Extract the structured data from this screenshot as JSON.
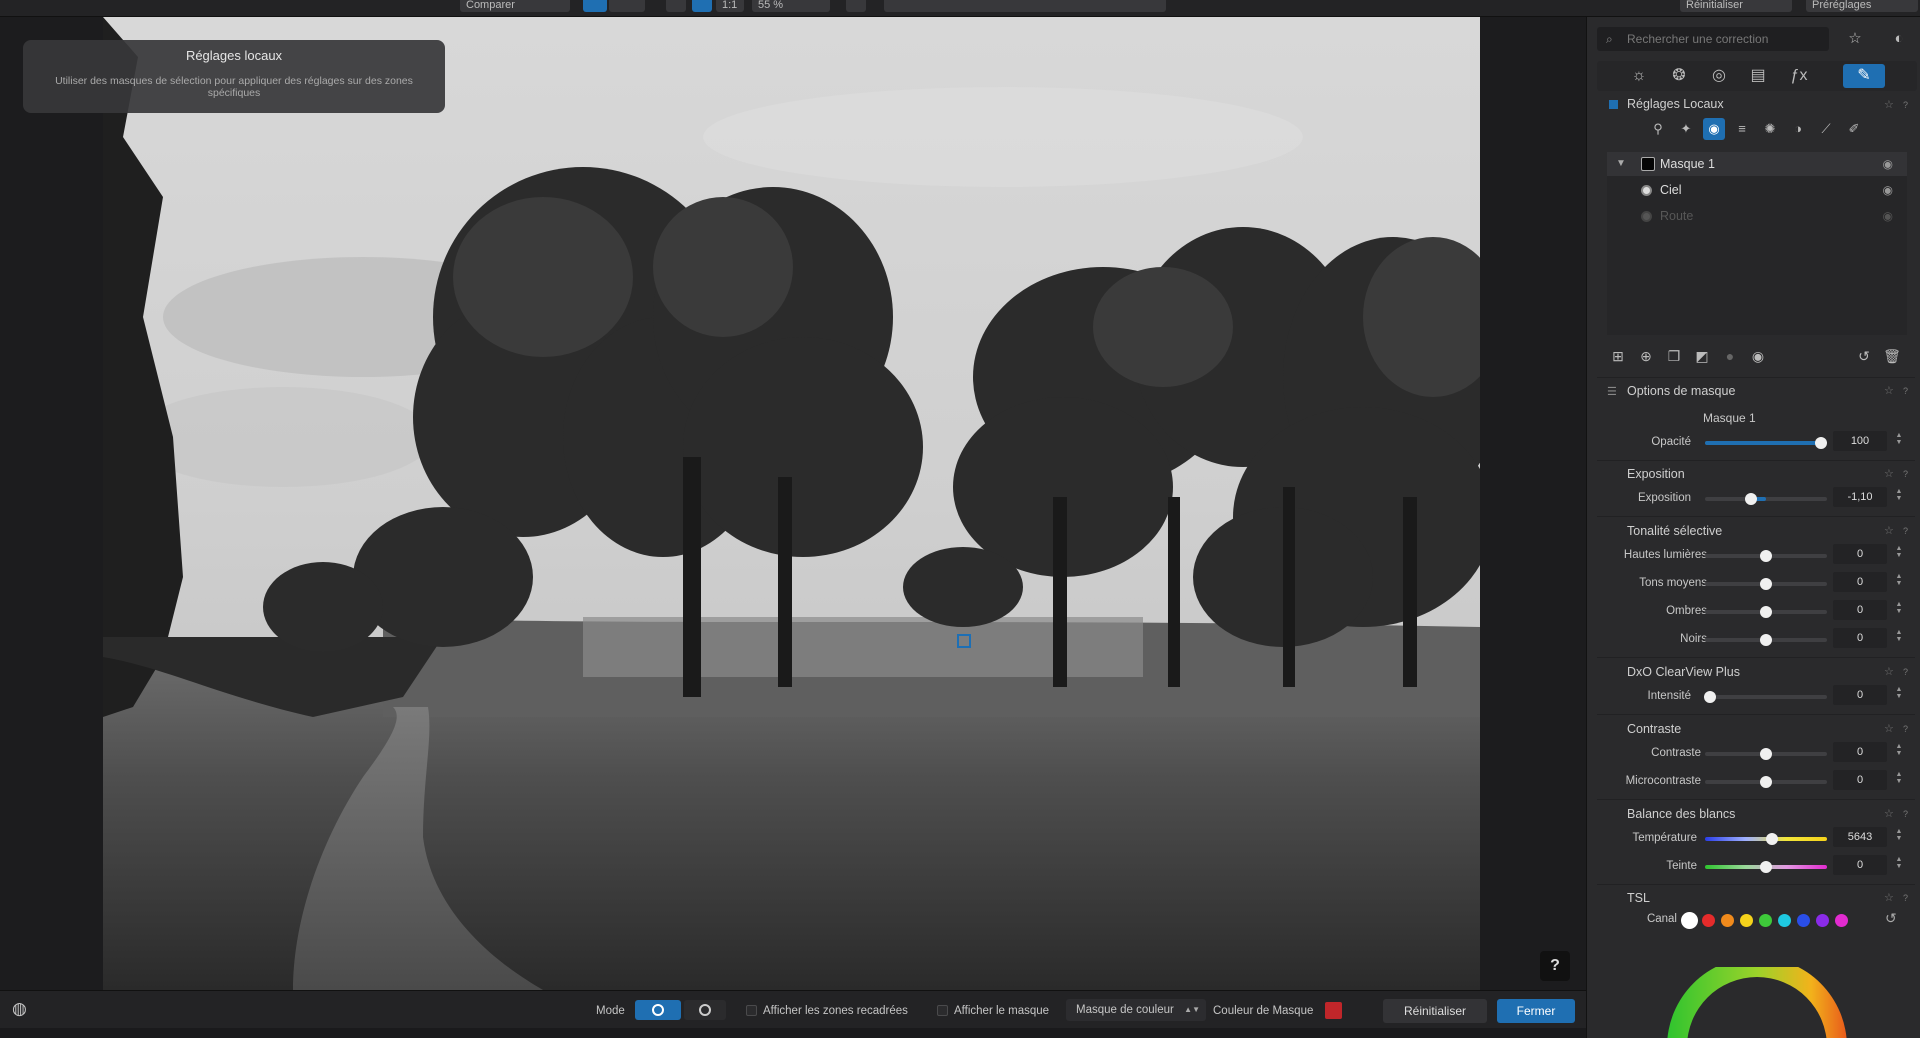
{
  "topbar": {
    "compare_label": "Comparer",
    "ratio_label": "1:1",
    "zoom_label": "55 %",
    "reset_label": "Réinitialiser",
    "presets_label": "Préréglages"
  },
  "tooltip": {
    "title": "Réglages locaux",
    "body": "Utiliser des masques de sélection pour appliquer des réglages sur des zones spécifiques"
  },
  "help_label": "?",
  "bottombar": {
    "mode_label": "Mode",
    "show_crop_label": "Afficher les zones recadrées",
    "show_mask_label": "Afficher le masque",
    "mask_select_value": "Masque de couleur",
    "mask_color_label": "Couleur de Masque",
    "mask_color": "#c0262a",
    "reset_label": "Réinitialiser",
    "close_label": "Fermer"
  },
  "panel": {
    "search_placeholder": "Rechercher une correction",
    "local_adjust_title": "Réglages Locaux",
    "masks": [
      {
        "name": "Masque 1",
        "selected": true
      },
      {
        "name": "Ciel",
        "selected": false
      },
      {
        "name": "Route",
        "selected": false,
        "disabled": true
      }
    ],
    "mask_options": {
      "title": "Options de masque",
      "mask_name": "Masque 1",
      "opacity_label": "Opacité",
      "opacity_value": "100",
      "opacity_fraction": 0.95
    },
    "exposure": {
      "title": "Exposition",
      "label": "Exposition",
      "value": "-1,10",
      "fraction": 0.38
    },
    "selective_tone": {
      "title": "Tonalité sélective",
      "rows": [
        {
          "label": "Hautes lumières",
          "value": "0",
          "fraction": 0.5
        },
        {
          "label": "Tons moyens",
          "value": "0",
          "fraction": 0.5
        },
        {
          "label": "Ombres",
          "value": "0",
          "fraction": 0.5
        },
        {
          "label": "Noirs",
          "value": "0",
          "fraction": 0.5
        }
      ]
    },
    "clearview": {
      "title": "DxO ClearView Plus",
      "label": "Intensité",
      "value": "0",
      "fraction": 0.04
    },
    "contrast": {
      "title": "Contraste",
      "rows": [
        {
          "label": "Contraste",
          "value": "0",
          "fraction": 0.5
        },
        {
          "label": "Microcontraste",
          "value": "0",
          "fraction": 0.5
        }
      ]
    },
    "white_balance": {
      "title": "Balance des blancs",
      "rows": [
        {
          "label": "Température",
          "value": "5643",
          "fraction": 0.55
        },
        {
          "label": "Teinte",
          "value": "0",
          "fraction": 0.5
        }
      ]
    },
    "tsl": {
      "title": "TSL",
      "channel_label": "Canal",
      "channel_colors": [
        "#ffffff",
        "#e52b2b",
        "#f08a1c",
        "#f5d21b",
        "#3ec93a",
        "#1ec8e0",
        "#2a4ee8",
        "#8a2be8",
        "#e22bd0"
      ]
    }
  },
  "colors": {
    "accent": "#1f6fb2"
  }
}
